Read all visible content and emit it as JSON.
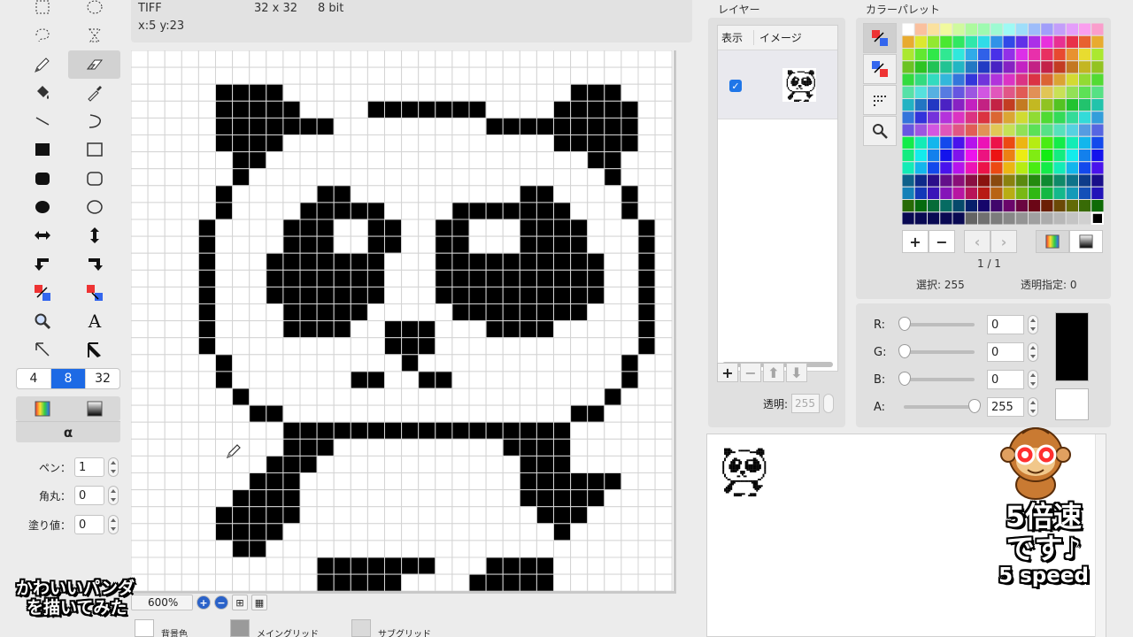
{
  "header": {
    "format": "TIFF",
    "size": "32 x 32",
    "depth": "8 bit",
    "cursor": "x:5 y:23"
  },
  "tools": {
    "icons": [
      [
        "rect-select-icon",
        "ellipse-select-icon"
      ],
      [
        "lasso-icon",
        "hourglass-select-icon"
      ],
      [
        "pencil-icon",
        "eraser-icon"
      ],
      [
        "paint-bucket-icon",
        "eyedropper-icon"
      ],
      [
        "line-icon",
        "curve-icon"
      ],
      [
        "filled-rect-icon",
        "rect-outline-icon"
      ],
      [
        "filled-rounded-rect-icon",
        "rounded-rect-icon"
      ],
      [
        "filled-ellipse-icon",
        "ellipse-icon"
      ],
      [
        "flip-horizontal-icon",
        "flip-vertical-icon"
      ],
      [
        "rotate-left-icon",
        "rotate-right-icon"
      ],
      [
        "swap-colors-icon",
        "swap-colors-alt-icon"
      ],
      [
        "zoom-icon",
        "text-icon"
      ],
      [
        "cursor-icon",
        "cursor-filled-icon"
      ]
    ],
    "active": "eraser-icon",
    "segments": [
      "4",
      "8",
      "32"
    ],
    "selected_segment": "8",
    "alpha_label": "α",
    "pen_label": "ペン：",
    "pen_value": "1",
    "corner_label": "角丸：",
    "corner_value": "0",
    "fill_label": "塗り値：",
    "fill_value": "0"
  },
  "canvas": {
    "zoom": "600%",
    "legend_bg": "背景色",
    "legend_main_grid": "メイングリッド",
    "legend_sub_grid": "サブグリッド",
    "pixels": [
      "",
      "",
      "",
      "",
      "",
      "",
      "",
      "",
      "",
      "",
      "",
      "",
      "",
      "",
      "",
      "",
      "",
      "",
      "",
      "",
      "",
      "",
      "",
      "",
      "",
      "",
      "",
      "",
      "",
      "",
      "",
      ""
    ]
  },
  "layers": {
    "title": "レイヤー",
    "col_show": "表示",
    "col_image": "イメージ",
    "opacity_label": "透明:",
    "opacity_value": "255",
    "checked": "✓"
  },
  "palette": {
    "title": "カラーパレット",
    "page": "1 / 1",
    "selected_label": "選択: 255",
    "transparent_label": "透明指定: 0"
  },
  "rgba": {
    "r_label": "R:",
    "r_value": "0",
    "g_label": "G:",
    "g_value": "0",
    "b_label": "B:",
    "b_value": "0",
    "a_label": "A:",
    "a_value": "255",
    "a_fraction": 1.0,
    "fg_color": "#000000",
    "bg_color": "#ffffff"
  },
  "overlay": {
    "caption_line1": "かわいいパンダ",
    "caption_line2": "を描いてみた",
    "speed_line1": "5倍速",
    "speed_line2": "です♪",
    "speed_line3": "5 speed"
  }
}
